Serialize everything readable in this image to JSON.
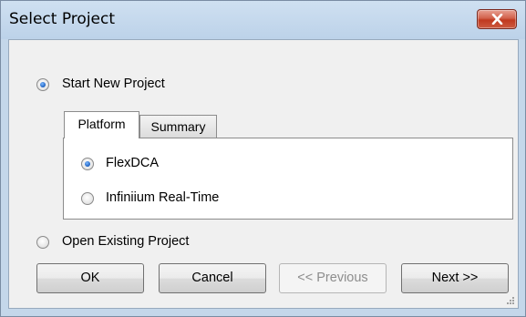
{
  "window": {
    "title": "Select Project"
  },
  "options": {
    "start_new": "Start New Project",
    "open_existing": "Open Existing Project",
    "start_new_selected": true
  },
  "tabs": [
    {
      "label": "Platform",
      "active": true
    },
    {
      "label": "Summary",
      "active": false
    }
  ],
  "platforms": [
    {
      "label": "FlexDCA",
      "selected": true
    },
    {
      "label": "Infiniium Real-Time",
      "selected": false
    }
  ],
  "buttons": {
    "ok": "OK",
    "cancel": "Cancel",
    "previous": "<< Previous",
    "next": "Next >>"
  },
  "colors": {
    "titlebar": "#c4d7ea",
    "close_button": "#c9432b",
    "client": "#f0f0f0"
  },
  "icons": [
    "close-icon",
    "resize-grip-icon"
  ]
}
